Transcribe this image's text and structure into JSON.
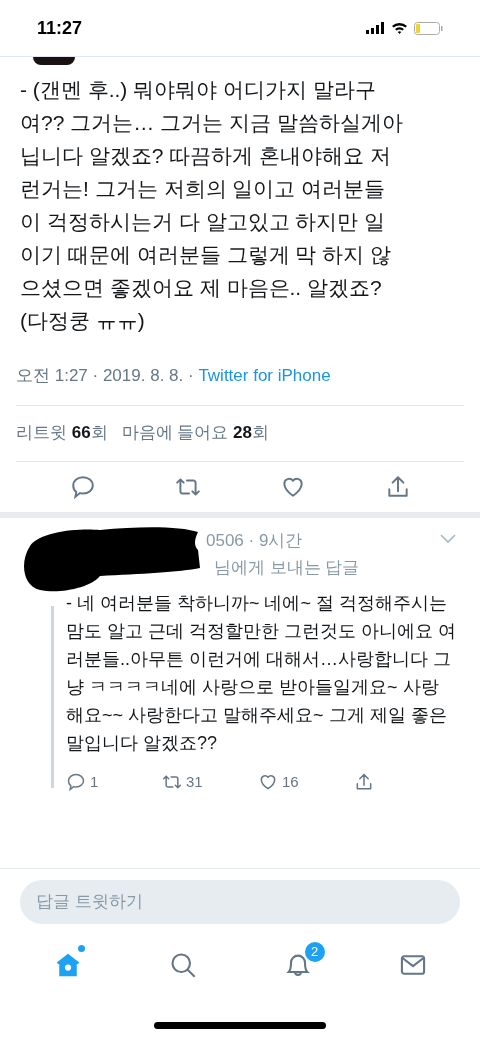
{
  "status_bar": {
    "time": "11:27"
  },
  "tweet": {
    "lines": [
      "- (갠멘 후..) 뭐야뭐야 어디가지 말라구",
      "여?? 그거는… 그거는 지금 말씀하실게아",
      "닙니다 알겠죠? 따끔하게 혼내야해요 저",
      "런거는! 그거는 저희의 일이고 여러분들",
      "이 걱정하시는거 다 알고있고 하지만 일",
      "이기 때문에 여러분들 그렇게 막 하지 않",
      "으셨으면 좋겠어요 제 마음은.. 알겠죠?",
      "(다정쿵 ㅠㅠ)"
    ],
    "time": "오전 1:27 · 2019. 8. 8. · ",
    "source": "Twitter for iPhone",
    "stats": [
      {
        "count": "66",
        "label_before": "리트윗 ",
        "label_after": "회"
      },
      {
        "count": "28",
        "label_before": "마음에 들어요 ",
        "label_after": "회"
      }
    ]
  },
  "reply": {
    "handle_time": "0506 · 9시간",
    "replying_to": "님에게 보내는 답글",
    "lines": [
      "- 네 여러분들 착하니까~ 네에~ 절 걱정해주시는",
      "맘도 알고 근데 걱정할만한 그런것도 아니에요 여",
      "러분들..아무튼 이런거에 대해서…사랑합니다 그",
      "냥 ㅋㅋㅋㅋ네에 사랑으로 받아들일게요~ 사랑",
      "해요~~ 사랑한다고 말해주세요~ 그게 제일 좋은",
      "말입니다 알겠죠??"
    ],
    "actions": [
      {
        "kind": "reply",
        "count": "1"
      },
      {
        "kind": "retweet",
        "count": "31"
      },
      {
        "kind": "like",
        "count": "16"
      },
      {
        "kind": "share"
      }
    ]
  },
  "composer": {
    "placeholder": "답글 트윗하기"
  },
  "tab_bar": [
    {
      "kind": "home",
      "selected": true,
      "dot": true
    },
    {
      "kind": "search",
      "selected": false
    },
    {
      "kind": "notifications",
      "selected": false,
      "badge": "2"
    },
    {
      "kind": "messages",
      "selected": false
    }
  ]
}
